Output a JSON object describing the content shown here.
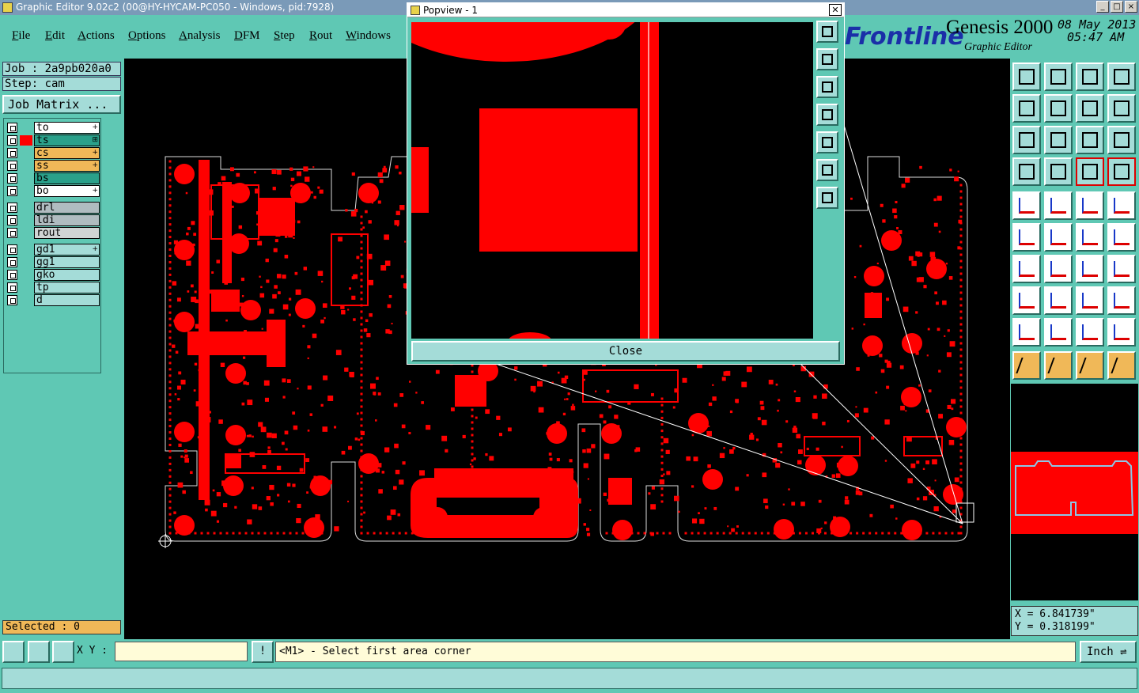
{
  "window": {
    "title": "Graphic Editor 9.02c2 (00@HY-HYCAM-PC050 - Windows, pid:7928)"
  },
  "menu": [
    "File",
    "Edit",
    "Actions",
    "Options",
    "Analysis",
    "DFM",
    "Step",
    "Rout",
    "Windows"
  ],
  "logo": {
    "brand": "Frontline",
    "product": "Genesis 2000",
    "subproduct": "Graphic Editor",
    "date": "08 May 2013",
    "time": "05:47 AM"
  },
  "job": {
    "job_label": "Job : 2a9pb020a0",
    "step_label": "Step: cam",
    "matrix_button": "Job Matrix ..."
  },
  "layers": [
    {
      "name": "to",
      "color": "#ffffff",
      "marker": "+"
    },
    {
      "name": "ts",
      "color": "#2aa08a",
      "marker": "⊞",
      "active": true
    },
    {
      "name": "cs",
      "color": "#f0b858",
      "marker": "+"
    },
    {
      "name": "ss",
      "color": "#f0b858",
      "marker": "+"
    },
    {
      "name": "bs",
      "color": "#2aa08a",
      "marker": ""
    },
    {
      "name": "bo",
      "color": "#ffffff",
      "marker": "+"
    },
    {
      "name": "drl",
      "color": "#b0bcc0",
      "marker": ""
    },
    {
      "name": "ldi",
      "color": "#b0bcc0",
      "marker": ""
    },
    {
      "name": "rout",
      "color": "#d0d4d4",
      "marker": ""
    },
    {
      "name": "gd1",
      "color": "#a4dcd8",
      "marker": "+"
    },
    {
      "name": "gg1",
      "color": "#a4dcd8",
      "marker": ""
    },
    {
      "name": "gko",
      "color": "#a4dcd8",
      "marker": ""
    },
    {
      "name": "tp",
      "color": "#a4dcd8",
      "marker": ""
    },
    {
      "name": "d",
      "color": "#a4dcd8",
      "marker": ""
    }
  ],
  "selected": "Selected : 0",
  "popview": {
    "title": "Popview - 1",
    "close_label": "Close"
  },
  "coords": {
    "x": "X = 6.841739\"",
    "y": "Y = 0.318199\""
  },
  "bottom": {
    "xy_label": "X Y :",
    "xy_value": "",
    "message": "<M1> - Select first area corner",
    "unit": "Inch"
  },
  "colors": {
    "layer_red": "#ff0000",
    "panel": "#5fc8b4",
    "button": "#a4dcd8",
    "highlight": "#f0b858"
  },
  "icons": [
    "zoom-fit-icon",
    "zoom-in-icon",
    "zoom-out-icon",
    "home-icon",
    "pan-icon",
    "measure-icon"
  ]
}
